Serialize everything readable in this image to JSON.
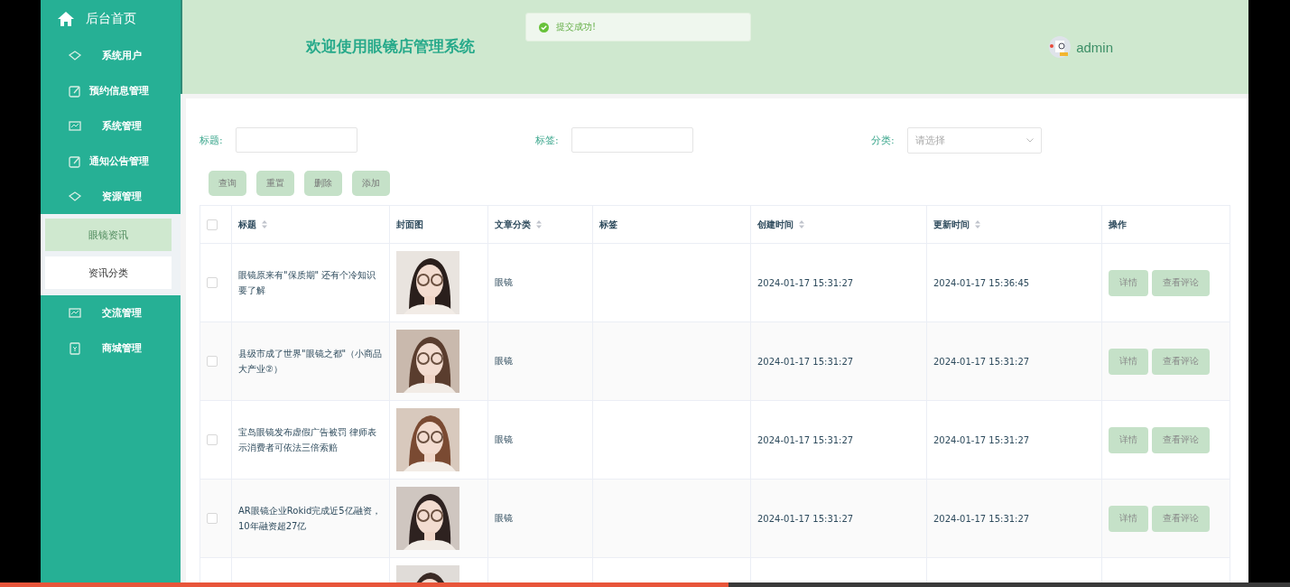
{
  "sidebar": {
    "home": "后台首页",
    "items": [
      {
        "label": "系统用户",
        "kind": "diamond"
      },
      {
        "label": "预约信息管理",
        "kind": "edit"
      },
      {
        "label": "系统管理",
        "kind": "chart"
      },
      {
        "label": "通知公告管理",
        "kind": "edit"
      },
      {
        "label": "资源管理",
        "kind": "diamond",
        "expanded": true,
        "children": [
          {
            "label": "眼镜资讯",
            "selected": true
          },
          {
            "label": "资讯分类",
            "selected": false
          }
        ]
      },
      {
        "label": "交流管理",
        "kind": "chart"
      },
      {
        "label": "商城管理",
        "kind": "bag"
      }
    ]
  },
  "header": {
    "title": "欢迎使用眼镜店管理系统",
    "user": "admin"
  },
  "toast": {
    "kind": "success",
    "text": "提交成功!"
  },
  "filters": [
    {
      "label": "标题:",
      "kind": "input"
    },
    {
      "label": "标签:",
      "kind": "input"
    },
    {
      "label": "分类:",
      "kind": "select",
      "placeholder": "请选择"
    }
  ],
  "actions": [
    "查询",
    "重置",
    "删除",
    "添加"
  ],
  "table": {
    "select_all_checked": false,
    "columns": [
      {
        "label": "标题",
        "sortable": true
      },
      {
        "label": "封面图",
        "sortable": false
      },
      {
        "label": "文章分类",
        "sortable": true
      },
      {
        "label": "标签",
        "sortable": false
      },
      {
        "label": "创建时间",
        "sortable": true
      },
      {
        "label": "更新时间",
        "sortable": true
      },
      {
        "label": "操作",
        "sortable": false
      }
    ],
    "rows": [
      {
        "kind": "full",
        "checked": false,
        "title": "眼镜原来有\"保质期\" 还有个冷知识要了解",
        "category": "眼镜",
        "created": "2024-01-17 15:31:27",
        "updated": "2024-01-17 15:36:45",
        "buttons": [
          "详情",
          "查看评论"
        ]
      },
      {
        "kind": "full",
        "checked": false,
        "title": "县级市成了世界\"眼镜之都\"（小商品大产业②）",
        "category": "眼镜",
        "created": "2024-01-17 15:31:27",
        "updated": "2024-01-17 15:31:27",
        "buttons": [
          "详情",
          "查看评论"
        ]
      },
      {
        "kind": "full",
        "checked": false,
        "title": "宝岛眼镜发布虚假广告被罚 律师表示消费者可依法三倍索赔",
        "category": "眼镜",
        "created": "2024-01-17 15:31:27",
        "updated": "2024-01-17 15:31:27",
        "buttons": [
          "详情",
          "查看评论"
        ]
      },
      {
        "kind": "full",
        "checked": false,
        "title": "AR眼镜企业Rokid完成近5亿融资，10年融资超27亿",
        "category": "眼镜",
        "created": "2024-01-17 15:31:27",
        "updated": "2024-01-17 15:31:27",
        "buttons": [
          "详情",
          "查看评论"
        ]
      },
      {
        "kind": "partial"
      }
    ]
  },
  "player": {
    "level": 0.565
  }
}
